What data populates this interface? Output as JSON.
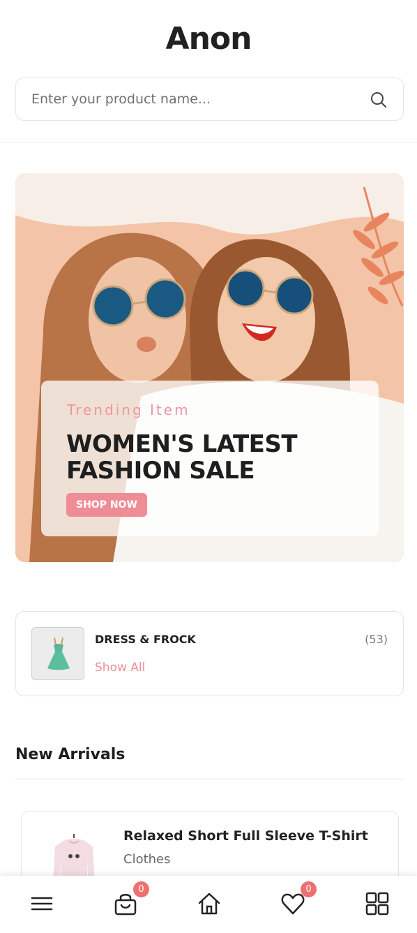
{
  "header": {
    "logo": "Anon"
  },
  "search": {
    "placeholder": "Enter your product name..."
  },
  "banner": {
    "subtitle": "Trending Item",
    "title": "WOMEN'S LATEST FASHION SALE",
    "button_label": "SHOP NOW"
  },
  "category": {
    "title": "DRESS & FROCK",
    "count": "(53)",
    "link_label": "Show All"
  },
  "new_arrivals": {
    "title": "New Arrivals",
    "items": [
      {
        "name": "Relaxed Short Full Sleeve T-Shirt",
        "category": "Clothes"
      }
    ]
  },
  "bottom_nav": {
    "items": [
      {
        "icon": "menu-icon"
      },
      {
        "icon": "shopping-bag-icon",
        "badge": "0"
      },
      {
        "icon": "home-icon"
      },
      {
        "icon": "heart-icon",
        "badge": "0"
      },
      {
        "icon": "grid-icon"
      }
    ]
  },
  "colors": {
    "accent": "#ef8d96",
    "badge": "#ef6f6f",
    "text": "#212121"
  }
}
